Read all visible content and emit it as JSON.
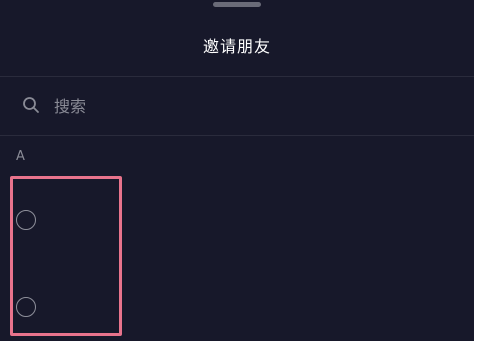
{
  "header": {
    "title": "邀请朋友"
  },
  "search": {
    "placeholder": "搜索",
    "icon": "search-icon"
  },
  "friend_list": {
    "section_letter": "A",
    "items": [
      {
        "selected": false,
        "icon": "radio-unchecked-icon"
      },
      {
        "selected": false,
        "icon": "radio-unchecked-icon"
      }
    ]
  },
  "colors": {
    "background": "#17182a",
    "highlight": "#e8738c",
    "text_primary": "#ffffff",
    "text_secondary": "#8a8b96"
  }
}
